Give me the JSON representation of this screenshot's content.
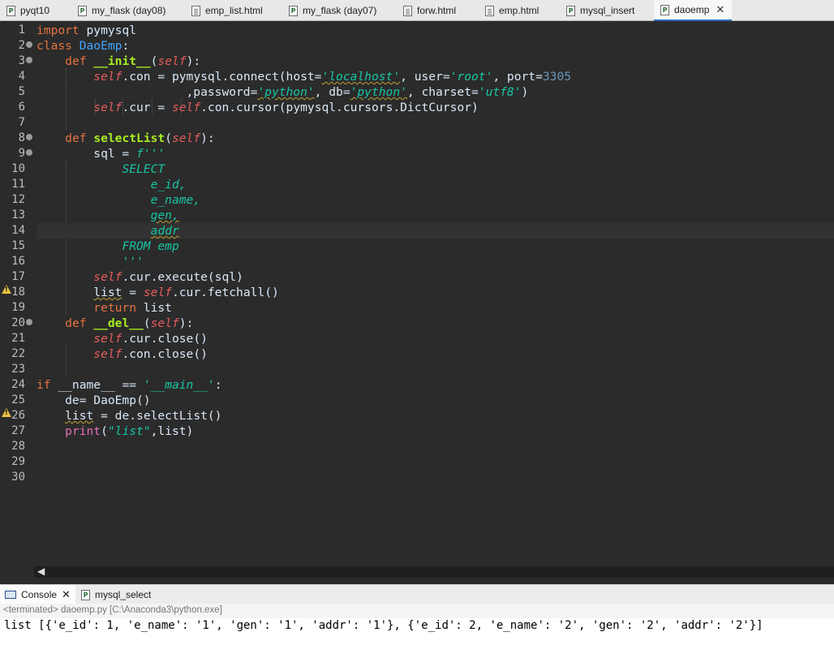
{
  "tabs": [
    {
      "label": "pyqt10",
      "icon": "python-file-icon",
      "active": false
    },
    {
      "label": "my_flask (day08)",
      "icon": "python-file-icon",
      "active": false
    },
    {
      "label": "emp_list.html",
      "icon": "document-icon",
      "active": false
    },
    {
      "label": "my_flask (day07)",
      "icon": "python-file-icon",
      "active": false
    },
    {
      "label": "forw.html",
      "icon": "document-icon",
      "active": false
    },
    {
      "label": "emp.html",
      "icon": "document-icon",
      "active": false
    },
    {
      "label": "mysql_insert",
      "icon": "python-file-icon",
      "active": false
    },
    {
      "label": "daoemp",
      "icon": "python-file-icon",
      "active": true
    }
  ],
  "code_lines": [
    "1",
    "2",
    "3",
    "4",
    "5",
    "6",
    "7",
    "8",
    "9",
    "10",
    "11",
    "12",
    "13",
    "14",
    "15",
    "16",
    "17",
    "18",
    "19",
    "20",
    "21",
    "22",
    "23",
    "24",
    "25",
    "26",
    "27",
    "28",
    "29",
    "30"
  ],
  "code": {
    "l1": [
      "import",
      " pymysql"
    ],
    "l2": [
      "class",
      " ",
      "DaoEmp",
      ":"
    ],
    "l3": [
      "    ",
      "def",
      " ",
      "__init__",
      "(",
      "self",
      "):"
    ],
    "l4": [
      "        ",
      "self",
      ".con = pymysql.connect(host=",
      "'localhost'",
      ", user=",
      "'root'",
      ", port=",
      "3305"
    ],
    "l5": [
      "                     ,password=",
      "'python'",
      ", db=",
      "'python'",
      ", charset=",
      "'utf8'",
      ")"
    ],
    "l6": [
      "        ",
      "self",
      ".cur = ",
      "self",
      ".con.cursor(pymysql.cursors.DictCursor)"
    ],
    "l8": [
      "    ",
      "def",
      " ",
      "selectList",
      "(",
      "self",
      "):"
    ],
    "l9": [
      "        sql = ",
      "f'''"
    ],
    "l10": [
      "            ",
      "SELECT"
    ],
    "l11": [
      "                ",
      "e_id,"
    ],
    "l12": [
      "                ",
      "e_name,"
    ],
    "l13": [
      "                ",
      "gen,"
    ],
    "l14": [
      "                ",
      "addr"
    ],
    "l15": [
      "            ",
      "FROM emp"
    ],
    "l16": [
      "            ",
      "'''"
    ],
    "l17": [
      "        ",
      "self",
      ".cur.execute(sql)"
    ],
    "l18": [
      "        ",
      "list",
      " = ",
      "self",
      ".cur.fetchall()"
    ],
    "l19": [
      "        ",
      "return",
      " list"
    ],
    "l20": [
      "    ",
      "def",
      " ",
      "__del__",
      "(",
      "self",
      "):"
    ],
    "l21": [
      "        ",
      "self",
      ".cur.close()"
    ],
    "l22": [
      "        ",
      "self",
      ".con.close()"
    ],
    "l24": [
      "if",
      " __name__ == ",
      "'__main__'",
      ":"
    ],
    "l25": [
      "    de= DaoEmp()"
    ],
    "l26": [
      "    ",
      "list",
      " = de.selectList()"
    ],
    "l27": [
      "    ",
      "print",
      "(",
      "\"list\"",
      ",list)"
    ]
  },
  "console": {
    "tabs": [
      {
        "label": "Console",
        "icon": "console-icon"
      },
      {
        "label": "mysql_select",
        "icon": "python-file-icon"
      }
    ],
    "status": "<terminated> daoemp.py [C:\\Anaconda3\\python.exe]",
    "output": "list [{'e_id': 1, 'e_name': '1', 'gen': '1', 'addr': '1'}, {'e_id': 2, 'e_name': '2', 'gen': '2', 'addr': '2'}]"
  },
  "colors": {
    "editor_bg": "#2b2b2b",
    "keyword": "#e6733f",
    "class_name": "#3ea5ff",
    "function_name": "#a7ec21",
    "self": "#e65c5c",
    "string": "#17c6a3",
    "number": "#6897bb",
    "builtin": "#e56fb5"
  }
}
